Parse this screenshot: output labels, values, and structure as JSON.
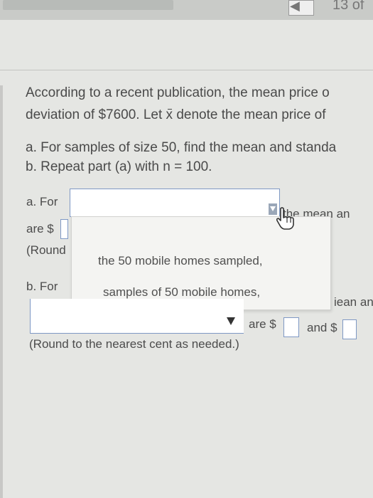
{
  "header": {
    "counter_text": "13 of",
    "nav_icon": "arrow-left-icon"
  },
  "question": {
    "line1": "According to a recent publication, the mean price o",
    "line2_before": "deviation of $7600. Let",
    "line2_var": "x",
    "line2_after": "denote the mean price of",
    "part_a": "a. For samples of size 50, find the mean and standa",
    "part_b": "b. Repeat part (a) with n = 100."
  },
  "answer_a": {
    "prefix": "a. For",
    "dropdown_value": "",
    "after_dropdown": "the mean an",
    "are_text": "are $",
    "round_text": "(Round"
  },
  "dropdown_menu": {
    "options": [
      "the 50 mobile homes sampled,",
      "samples of 50 mobile homes,"
    ]
  },
  "answer_b": {
    "prefix": "b. For",
    "after_menu": "iean an",
    "dropdown_value": "",
    "are_text": "are $",
    "and_text": "and $",
    "round_text": "(Round to the nearest cent as needed.)"
  }
}
